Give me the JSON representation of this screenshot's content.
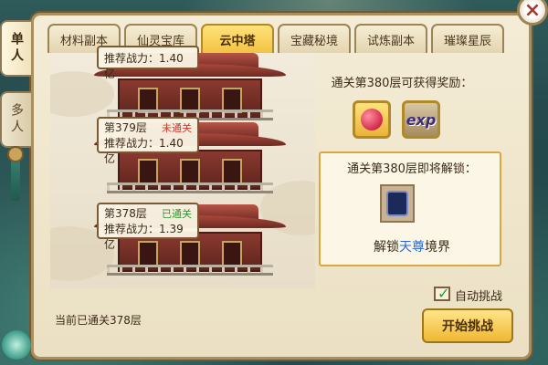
{
  "side_tabs": [
    {
      "label": "单人",
      "active": true
    },
    {
      "label": "多人",
      "active": false
    }
  ],
  "tabs": [
    {
      "label": "材料副本",
      "active": false
    },
    {
      "label": "仙灵宝库",
      "active": false
    },
    {
      "label": "云中塔",
      "active": true
    },
    {
      "label": "宝藏秘境",
      "active": false
    },
    {
      "label": "试炼副本",
      "active": false
    },
    {
      "label": "璀璨星辰",
      "active": false
    }
  ],
  "close": {
    "label": "×"
  },
  "floors": [
    {
      "name": "",
      "power": "推荐战力：1.40亿",
      "status": ""
    },
    {
      "name": "第379层",
      "power": "推荐战力：1.40亿",
      "status": "未通关"
    },
    {
      "name": "第378层",
      "power": "推荐战力：1.39亿",
      "status": "已通关"
    }
  ],
  "reward": {
    "title": "通关第380层可获得奖励：",
    "items": [
      {
        "icon": "peach-icon",
        "label": ""
      },
      {
        "icon": "exp-icon",
        "label": "exp"
      }
    ]
  },
  "unlock": {
    "title": "通关第380层即将解锁：",
    "icon": "realm-badge-icon",
    "prefix": "解锁",
    "highlight": "天尊",
    "suffix": "境界"
  },
  "auto_challenge": {
    "label": "自动挑战",
    "checked": true
  },
  "progress_text": "当前已通关378层",
  "start_button": "开始挑战",
  "colors": {
    "accent_gold": "#f2c443",
    "locked_red": "#d0342a",
    "cleared_green": "#2a9a2a",
    "highlight_blue": "#2a6ad8"
  }
}
